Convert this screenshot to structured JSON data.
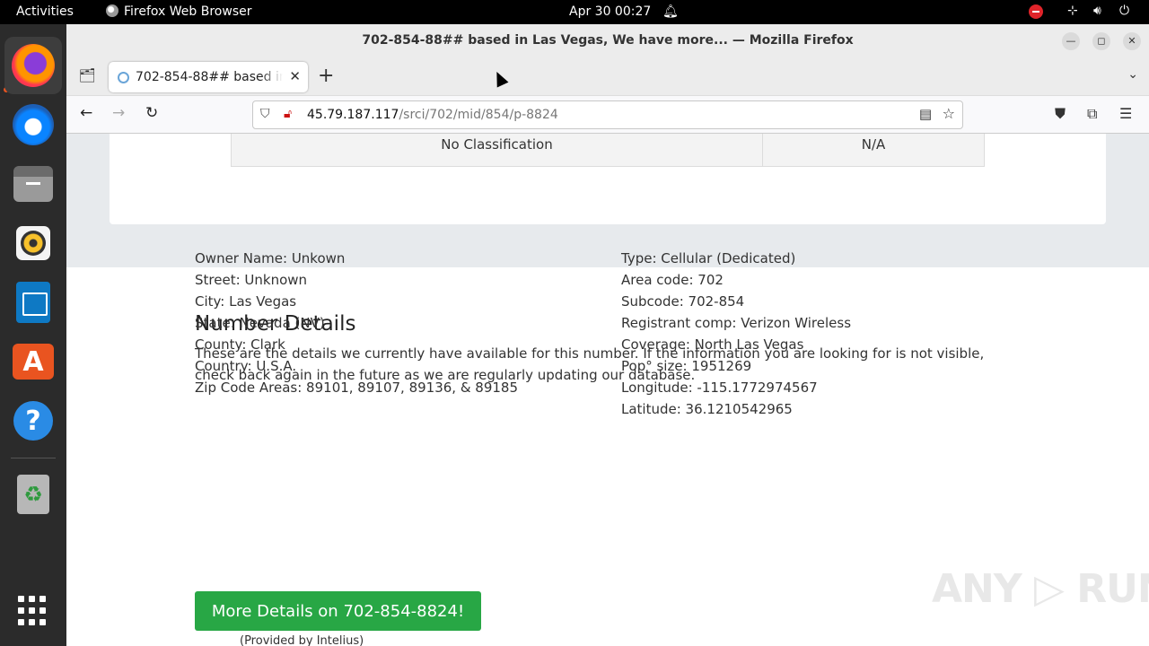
{
  "topbar": {
    "activities": "Activities",
    "app_menu": "Firefox Web Browser",
    "clock": "Apr 30  00:27",
    "bell_icon": "bell-icon",
    "network_icon": "network-icon",
    "volume_icon": "volume-icon",
    "power_icon": "power-icon",
    "alert_color": "#e0242a"
  },
  "dock": {
    "items": [
      {
        "name": "Firefox",
        "icon": "firefox-icon",
        "active": true
      },
      {
        "name": "Thunderbird",
        "icon": "thunderbird-icon"
      },
      {
        "name": "Files",
        "icon": "files-icon"
      },
      {
        "name": "Rhythmbox",
        "icon": "rhythmbox-icon"
      },
      {
        "name": "LibreOffice Writer",
        "icon": "writer-icon"
      },
      {
        "name": "Ubuntu Software",
        "icon": "software-store-icon"
      },
      {
        "name": "Help",
        "icon": "help-icon"
      },
      {
        "name": "Trash",
        "icon": "trash-icon"
      }
    ],
    "accent": "#e95420"
  },
  "window": {
    "title": "702-854-88## based in Las Vegas, We have more... — Mozilla Firefox"
  },
  "tab": {
    "title": "702-854-88## based in Las Vegas",
    "close": "✕",
    "new_tab": "+"
  },
  "navbar": {
    "url_host": "45.79.187.117",
    "url_path": "/srci/702/mid/854/p-8824"
  },
  "page": {
    "classification": {
      "label": "No Classification",
      "value": "N/A"
    },
    "details": {
      "heading": "Number Details",
      "description": "These are the details we currently have available for this number. If the information you are looking for is not visible, check back again in the future as we are regularly updating our database.",
      "left": [
        "Owner Name: Unkown",
        "Street: Unknown",
        "City: Las Vegas",
        "State: Nevada (NV)",
        "County: Clark",
        "Country: U.S.A.",
        "Zip Code Areas: 89101, 89107, 89136, & 89185"
      ],
      "right": [
        "Type: Cellular (Dedicated)",
        "Area code: 702",
        "Subcode: 702-854",
        "Registrant comp: Verizon Wireless",
        "Coverage: North Las Vegas",
        "Pop° size: 1951269",
        "Longitude: -115.1772974567",
        "Latitude: 36.1210542965"
      ],
      "button": "More Details on 702-854-8824!",
      "provided": "(Provided by Intelius)",
      "button_color": "#28a745"
    },
    "watermark": "ANY ▷ RUN"
  }
}
